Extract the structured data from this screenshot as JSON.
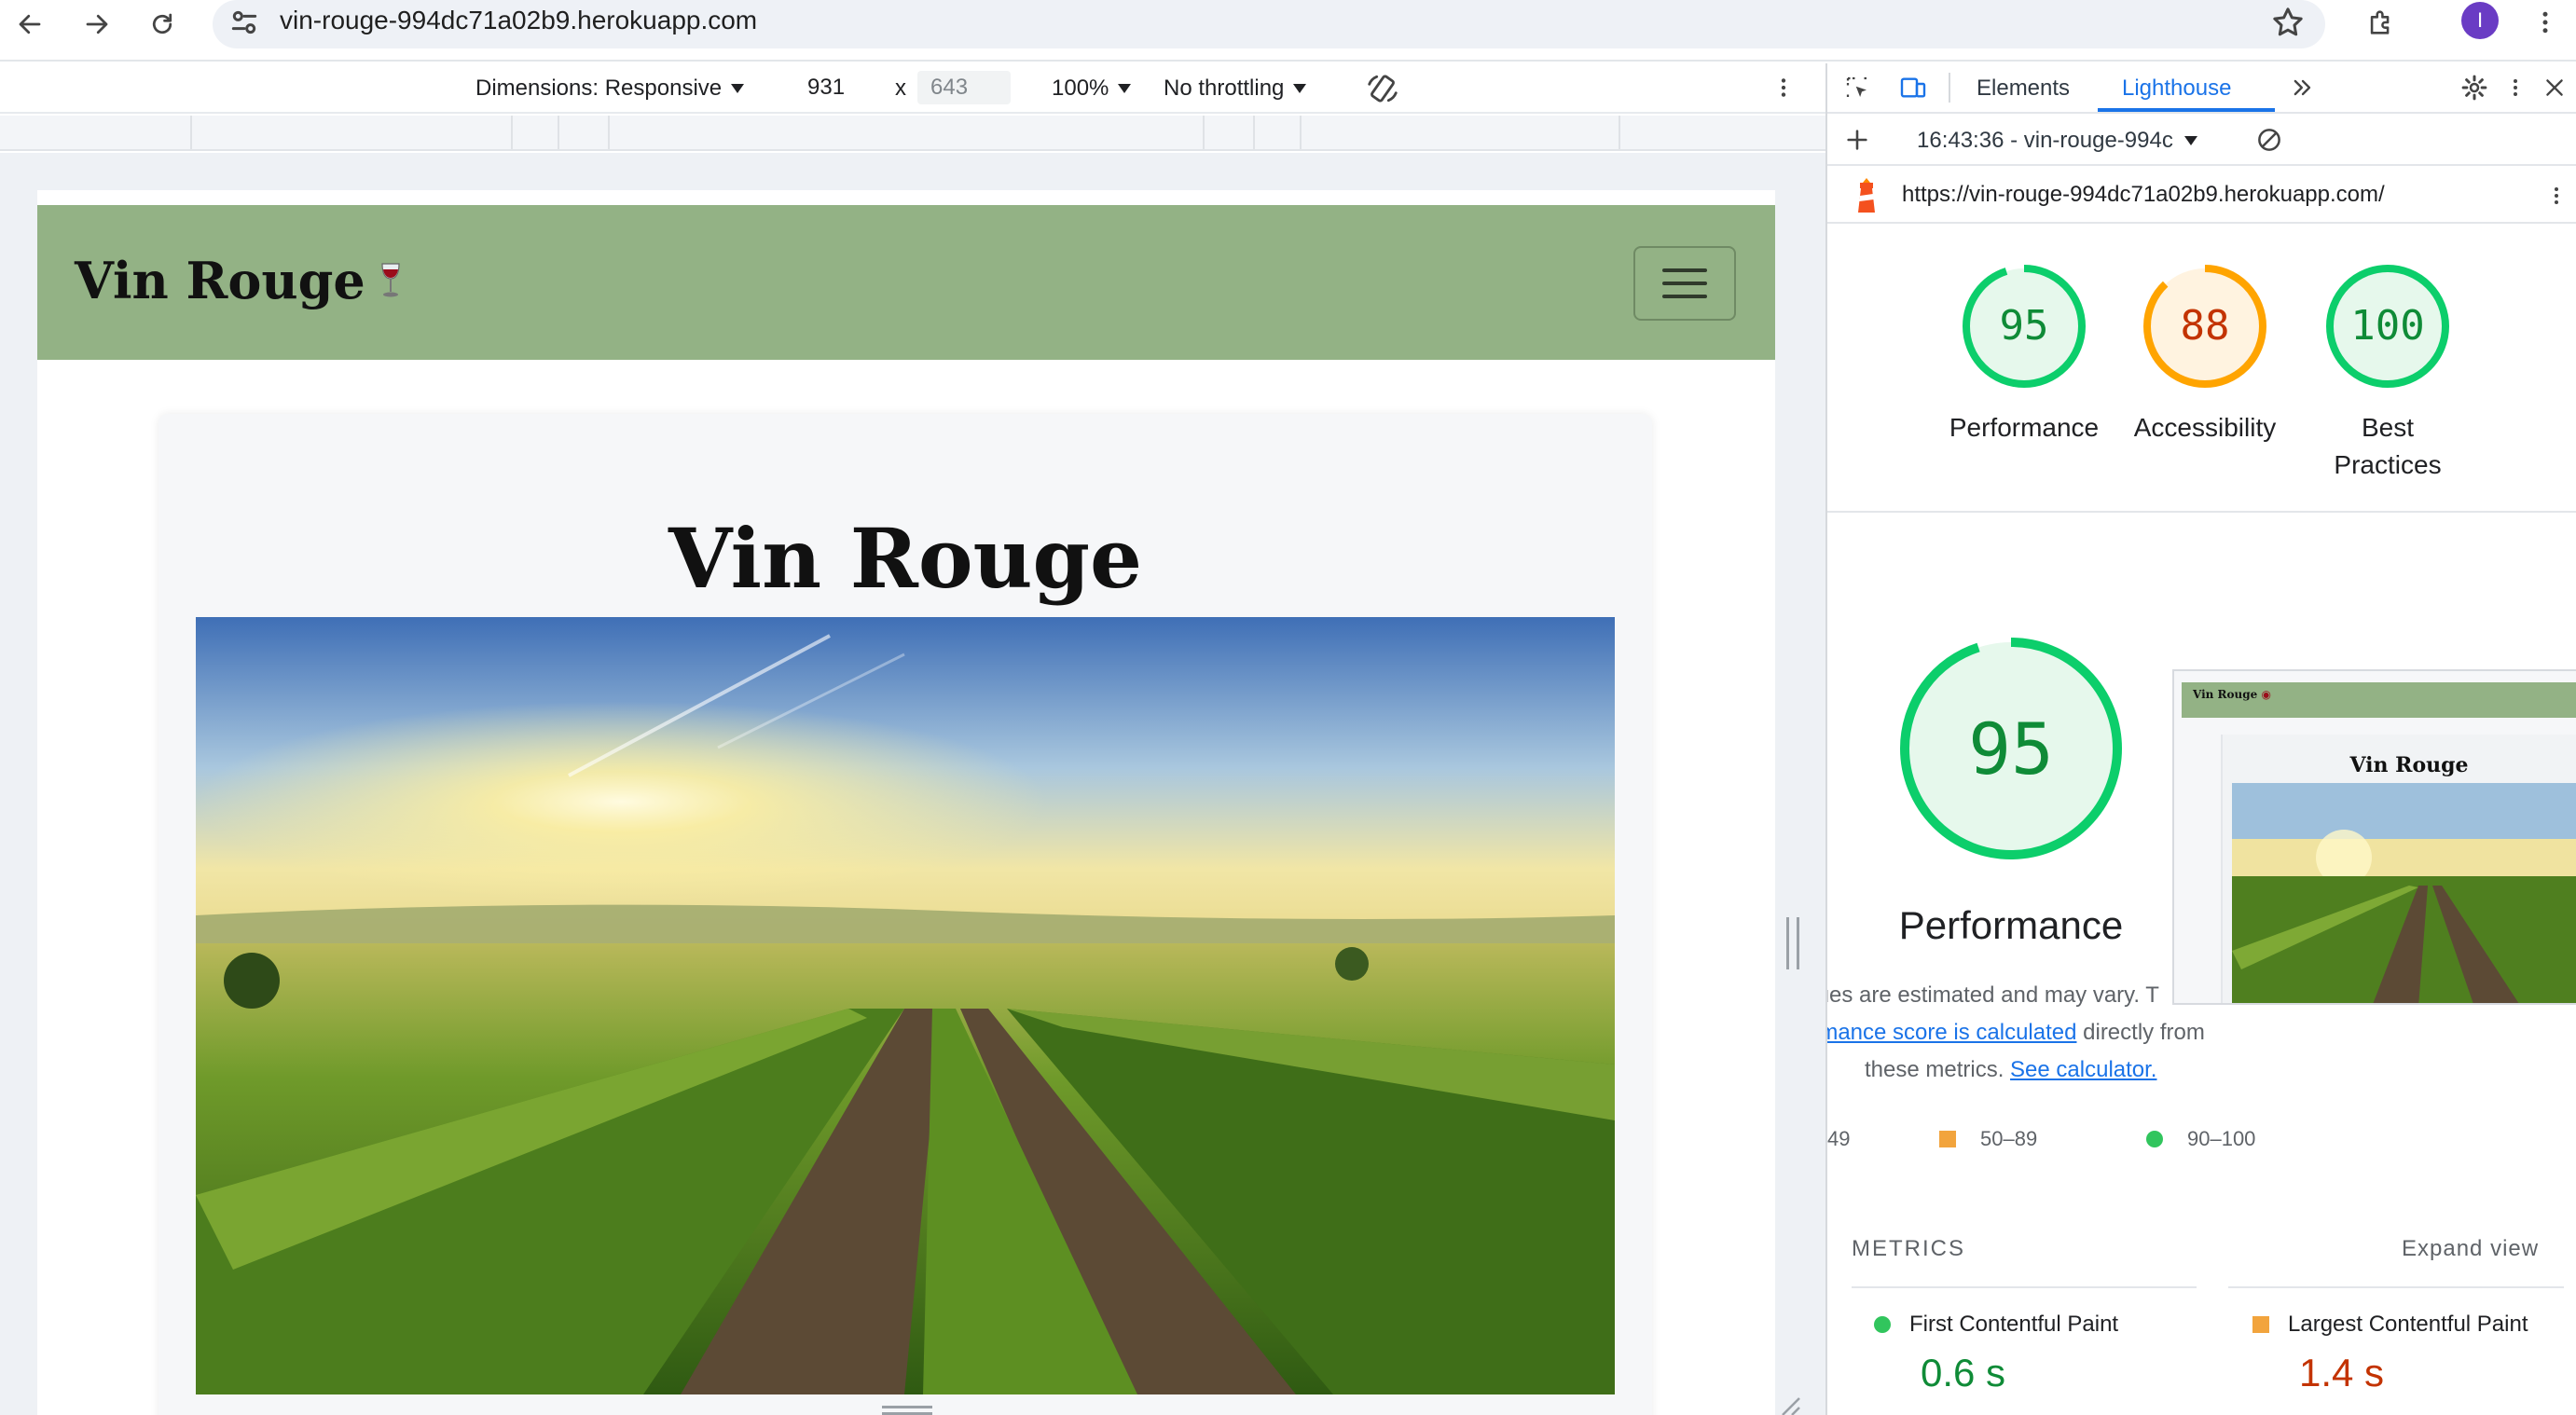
{
  "browser": {
    "url": "vin-rouge-994dc71a02b9.herokuapp.com",
    "profile_initial": "I"
  },
  "device_toolbar": {
    "dimensions_label": "Dimensions: Responsive",
    "width": "931",
    "times": "x",
    "height": "643",
    "zoom": "100%",
    "throttling": "No throttling"
  },
  "site": {
    "brand": "Vin Rouge",
    "hero_title": "Vin Rouge"
  },
  "devtools": {
    "tabs": [
      "Elements",
      "Lighthouse"
    ],
    "report_label": "16:43:36 - vin-rouge-994c",
    "report_url": "https://vin-rouge-994dc71a02b9.herokuapp.com/",
    "scores": [
      {
        "label": "Performance",
        "value": "95",
        "color": "#0cce6b"
      },
      {
        "label": "Accessibility",
        "value": "88",
        "color": "#ffa400"
      },
      {
        "label": "Best Practices",
        "value": "100",
        "color": "#0cce6b"
      }
    ],
    "main_score": {
      "value": "95",
      "label": "Performance",
      "color": "#0cce6b"
    },
    "note": {
      "line1": "alues are estimated and may vary. T",
      "link1": "ormance score is calculated",
      "line2_rest": " directly from",
      "line3": "these metrics. ",
      "link2": "See calculator."
    },
    "thumb": {
      "brand": "Vin Rouge",
      "title": "Vin Rouge"
    },
    "legend": {
      "fail": "49",
      "average": "50–89",
      "pass": "90–100"
    },
    "metrics_heading": "METRICS",
    "expand_view": "Expand view",
    "metrics": [
      {
        "name": "First Contentful Paint",
        "value": "0.6 s",
        "status": "pass"
      },
      {
        "name": "Largest Contentful Paint",
        "value": "1.4 s",
        "status": "average"
      }
    ]
  },
  "colors": {
    "navbar": "#93b285",
    "pass": "#0cce6b",
    "average": "#ffa400",
    "accent": "#1a73e8"
  }
}
